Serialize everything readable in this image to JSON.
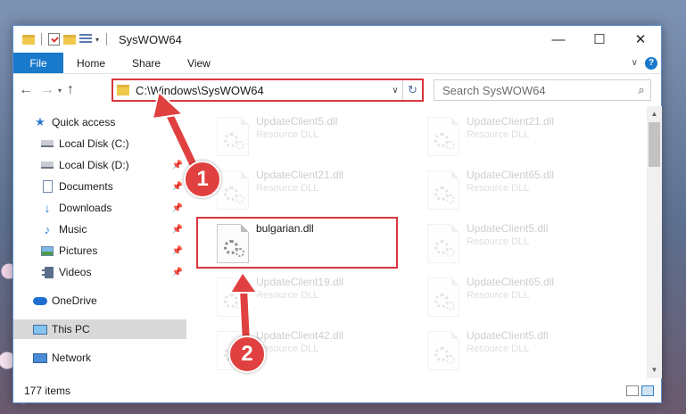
{
  "window": {
    "title": "SysWOW64",
    "controls": {
      "minimize": "—",
      "maximize": "☐",
      "close": "✕"
    }
  },
  "ribbon": {
    "file": "File",
    "tabs": [
      "Home",
      "Share",
      "View"
    ],
    "help": "?"
  },
  "address": {
    "path": "C:\\Windows\\SysWOW64",
    "search_placeholder": "Search SysWOW64"
  },
  "nav": {
    "quick_access": "Quick access",
    "items": [
      {
        "label": "Local Disk (C:)",
        "icon": "drive-icon"
      },
      {
        "label": "Local Disk (D:)",
        "icon": "drive-icon"
      },
      {
        "label": "Documents",
        "icon": "documents-icon"
      },
      {
        "label": "Downloads",
        "icon": "downloads-icon"
      },
      {
        "label": "Music",
        "icon": "music-icon"
      },
      {
        "label": "Pictures",
        "icon": "pictures-icon"
      },
      {
        "label": "Videos",
        "icon": "videos-icon"
      }
    ],
    "onedrive": "OneDrive",
    "this_pc": "This PC",
    "network": "Network"
  },
  "files": {
    "col1": [
      {
        "name": "UpdateClient5.dll",
        "desc": "Resource DLL"
      },
      {
        "name": "UpdateClient21.dll",
        "desc": "Resource DLL"
      },
      {
        "name": "bulgarian.dll",
        "desc": ""
      },
      {
        "name": "UpdateClient19.dll",
        "desc": "Resource DLL"
      },
      {
        "name": "UpdateClient42.dll",
        "desc": "Resource DLL"
      }
    ],
    "col2": [
      {
        "name": "UpdateClient21.dll",
        "desc": "Resource DLL"
      },
      {
        "name": "UpdateClient65.dll",
        "desc": "Resource DLL"
      },
      {
        "name": "UpdateClient5.dll",
        "desc": "Resource DLL"
      },
      {
        "name": "UpdateClient65.dll",
        "desc": "Resource DLL"
      },
      {
        "name": "UpdateClient5.dll",
        "desc": "Resource DLL"
      }
    ]
  },
  "status": {
    "items": "177 items"
  },
  "annotations": {
    "step1": "1",
    "step2": "2"
  },
  "colors": {
    "accent": "#1979ca",
    "highlight": "#d9363e"
  }
}
